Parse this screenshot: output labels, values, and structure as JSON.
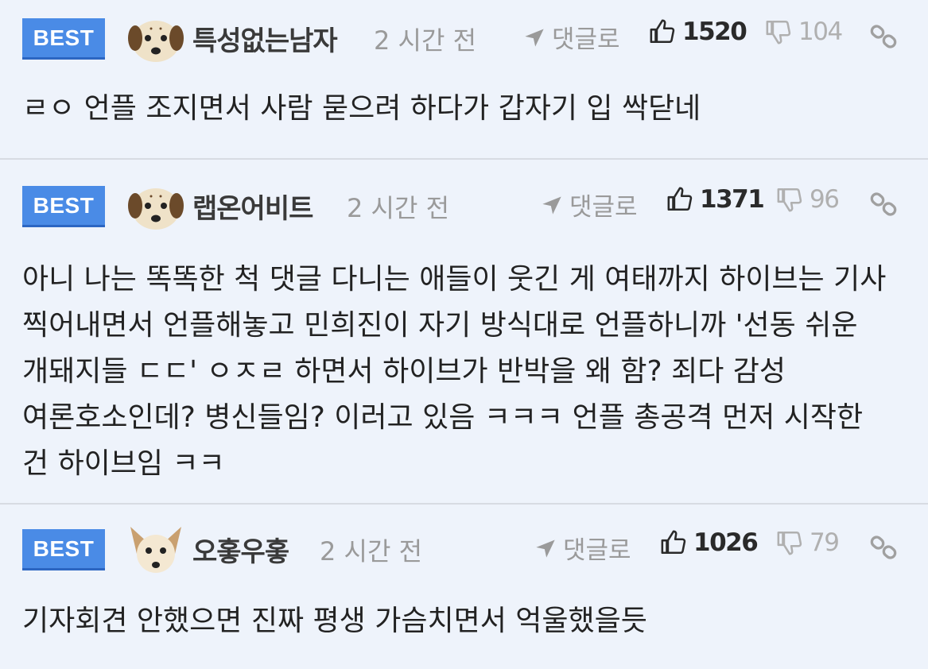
{
  "comments": [
    {
      "badge": "BEST",
      "username": "특성없는남자",
      "timestamp": "2 시간 전",
      "reply_label": "댓글로",
      "likes": "1520",
      "dislikes": "104",
      "avatar": "puppy-face-icon",
      "text": "ㄹㅇ 언플 조지면서 사람 묻으려 하다가 갑자기 입 싹닫네"
    },
    {
      "badge": "BEST",
      "username": "랩온어비트",
      "timestamp": "2 시간 전",
      "reply_label": "댓글로",
      "likes": "1371",
      "dislikes": "96",
      "avatar": "puppy-face-icon",
      "text": "아니 나는 똑똑한 척 댓글 다니는 애들이 웃긴 게 여태까지 하이브는 기사 찍어내면서 언플해놓고 민희진이 자기 방식대로 언플하니까 '선동 쉬운 개돼지들 ㄷㄷ' ㅇㅈㄹ 하면서 하이브가 반박을 왜 함? 죄다 감성 여론호소인데? 병신들임? 이러고 있음 ㅋㅋㅋ 언플 총공격 먼저 시작한 건 하이브임 ㅋㅋ"
    },
    {
      "badge": "BEST",
      "username": "오홓우홓",
      "timestamp": "2 시간 전",
      "reply_label": "댓글로",
      "likes": "1026",
      "dislikes": "79",
      "avatar": "chihuahua-face-icon",
      "text": "기자회견 안했으면 진짜 평생 가슴치면서 억울했을듯"
    }
  ],
  "colors": {
    "badge": "#4a8be6",
    "background": "#eef3fb",
    "divider": "#d7dbe2",
    "muted": "#9a9a9a"
  }
}
